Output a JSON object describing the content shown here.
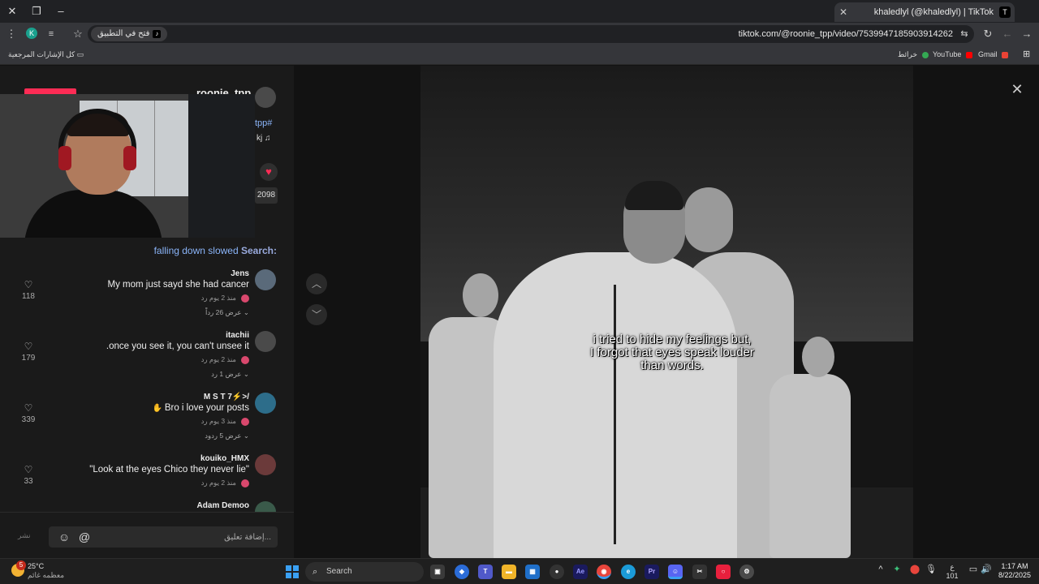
{
  "window": {
    "tab_title": "khaledlyl (@khaledlyl) | TikTok",
    "tab_favicon": "T"
  },
  "toolbar": {
    "url": "tiktok.com/@roonie_tpp/video/7539947185903914262",
    "open_in_app": "فتح في التطبيق",
    "profile_initial": "K"
  },
  "bookmarks": {
    "all_bookmarks": "كل الإشارات المرجعية",
    "items": [
      {
        "label": "Gmail",
        "color": "#ea4335"
      },
      {
        "label": "YouTube",
        "color": "#ff0000"
      },
      {
        "label": "خرائط",
        "color": "#34a853"
      }
    ]
  },
  "profile_card": {
    "username_fragment": "roonie_tpp",
    "hashtag_fragment": "tpp#",
    "music_fragment": "kj ♫",
    "count_fragment": "2098"
  },
  "search_hint": {
    "prefix": "Search:",
    "query": "falling down slowed"
  },
  "comments": [
    {
      "user": "Jens",
      "text": "My mom just sayd she had cancer",
      "meta": "منذ 2 يوم   رد",
      "replies": "عرض 26 رداً",
      "likes": "118",
      "avatar_color": "#5a6a7a"
    },
    {
      "user": "itachii",
      "text": ".once you see it, you can't unsee it",
      "meta": "منذ 2 يوم   رد",
      "replies": "عرض 1 رد",
      "likes": "179",
      "avatar_color": "#4a4a4a"
    },
    {
      "user": "M S T 7⚡>/",
      "text": "Bro i love your posts",
      "meta": "منذ 3 يوم   رد",
      "replies": "عرض 5 ردود",
      "likes": "339",
      "avatar_color": "#2d6d8a"
    },
    {
      "user": "kouiko_HMX",
      "text": "\"Look at the eyes Chico they never lie\"",
      "meta": "منذ 2 يوم   رد",
      "replies": "",
      "likes": "33",
      "avatar_color": "#6b3a3a"
    },
    {
      "user": "Adam Demoo",
      "text": "",
      "meta": "",
      "replies": "",
      "likes": "",
      "avatar_color": "#3a5a4a"
    }
  ],
  "video": {
    "caption_line1": "i tried to hide my feelings but,",
    "caption_line2": "I forgot that eyes speak louder",
    "caption_line3": "than words."
  },
  "comment_input": {
    "placeholder": "إضافة تعليق...",
    "post_label": "نشر"
  },
  "taskbar": {
    "temperature": "25°C",
    "weather_desc": "معظمه غائم",
    "weather_badge": "5",
    "search_label": "Search",
    "tray_lang_top": "ع",
    "tray_lang_bottom": "101",
    "time": "1:17 AM",
    "date": "8/22/2025"
  }
}
